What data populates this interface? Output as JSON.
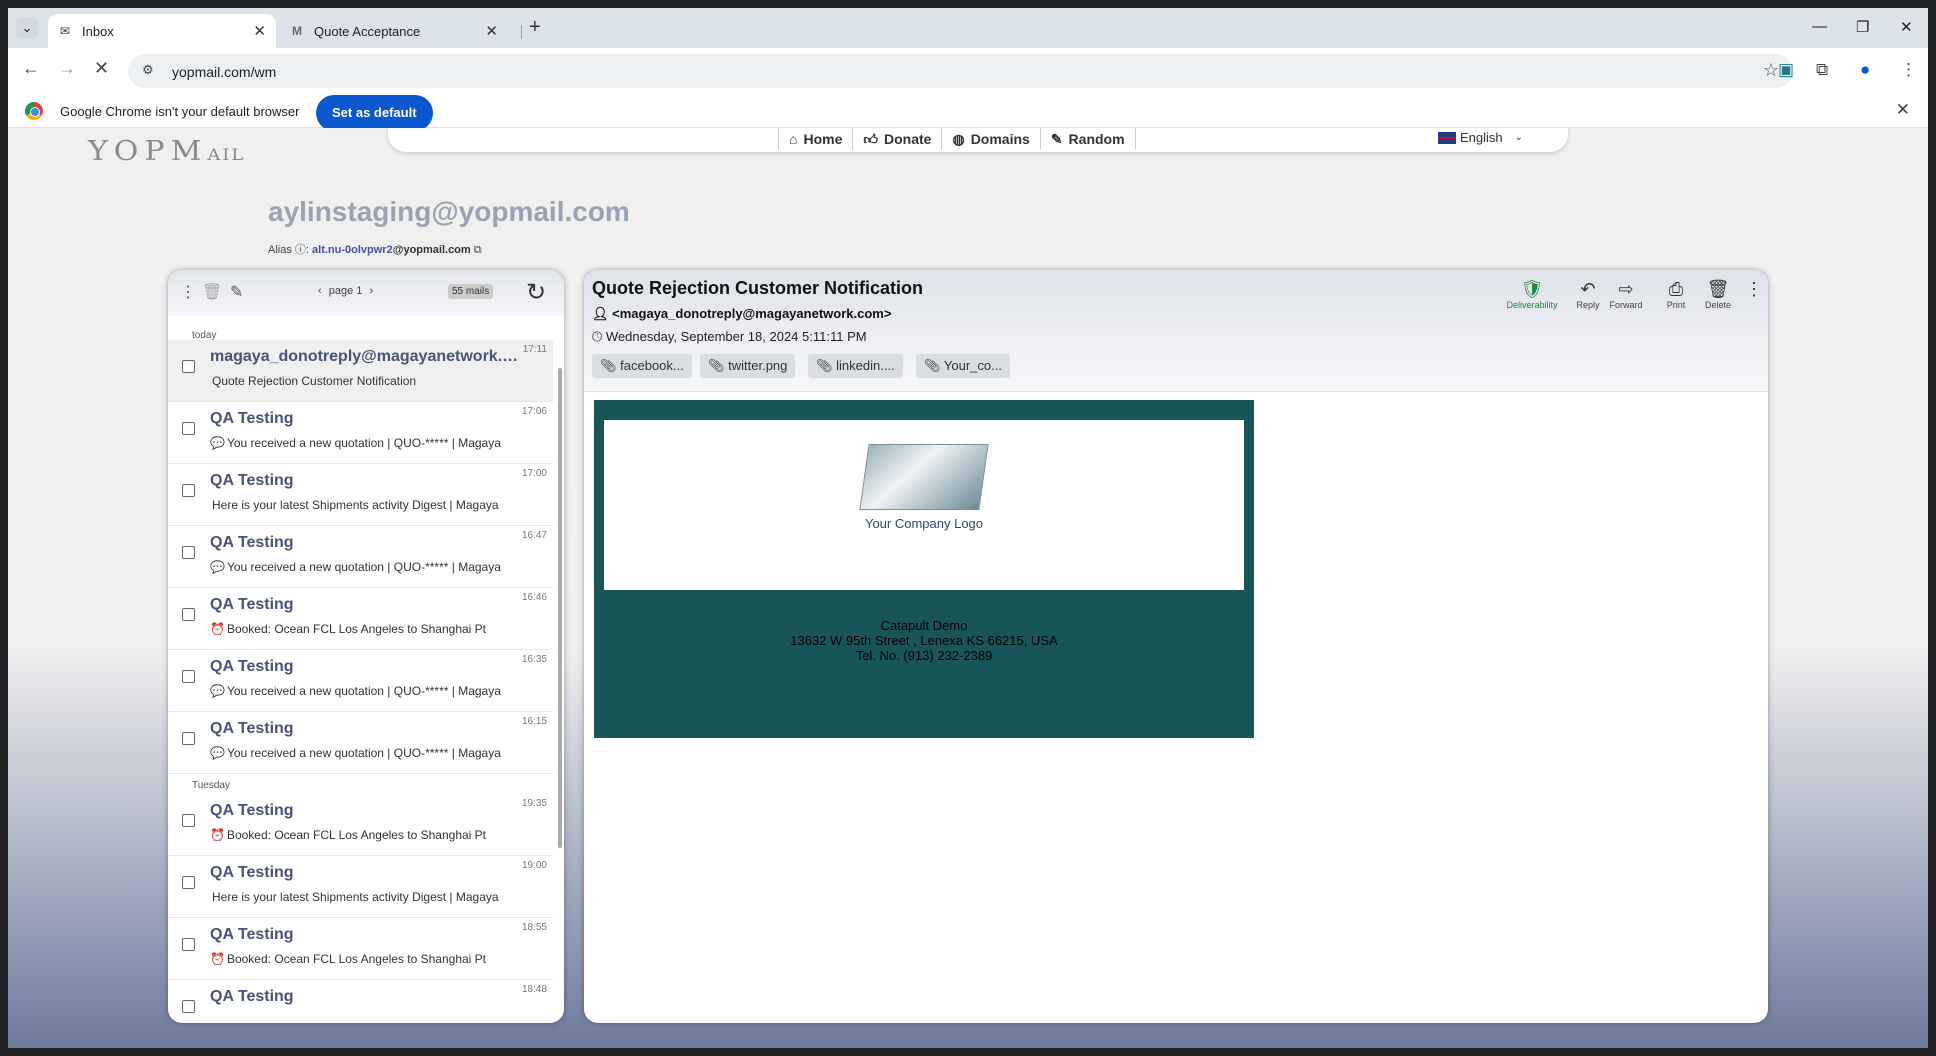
{
  "browser": {
    "tabs": [
      {
        "title": "Inbox",
        "active": true
      },
      {
        "title": "Quote Acceptance",
        "active": false
      }
    ],
    "url": "yopmail.com/wm",
    "infobar": {
      "message": "Google Chrome isn't your default browser",
      "button": "Set as default"
    }
  },
  "site": {
    "logo": "YOPMAIL",
    "nav": [
      "Home",
      "Donate",
      "Domains",
      "Random"
    ],
    "language": "English",
    "mailbox": "aylinstaging@yopmail.com",
    "alias_label": "Alias",
    "alias_link": "alt.nu-0olvpwr2",
    "alias_domain": "@yopmail.com"
  },
  "inbox": {
    "page": "page 1",
    "count": "55 mails",
    "groups": [
      {
        "day": "today",
        "mails": [
          {
            "from": "magaya_donotreply@magayanetwork.com",
            "time": "17:11",
            "subject": "Quote Rejection Customer Notification",
            "emoji": "",
            "selected": true
          },
          {
            "from": "QA Testing",
            "time": "17:06",
            "subject": "You received a new quotation | QUO-***** | Magaya",
            "emoji": "💬"
          },
          {
            "from": "QA Testing",
            "time": "17:00",
            "subject": "Here is your latest Shipments activity Digest | Magaya",
            "emoji": ""
          },
          {
            "from": "QA Testing",
            "time": "16:47",
            "subject": "You received a new quotation | QUO-***** | Magaya",
            "emoji": "💬"
          },
          {
            "from": "QA Testing",
            "time": "16:46",
            "subject": "Booked: Ocean FCL Los Angeles to Shanghai Pt",
            "emoji": "⏰"
          },
          {
            "from": "QA Testing",
            "time": "16:35",
            "subject": "You received a new quotation | QUO-***** | Magaya",
            "emoji": "💬"
          },
          {
            "from": "QA Testing",
            "time": "16:15",
            "subject": "You received a new quotation | QUO-***** | Magaya",
            "emoji": "💬"
          }
        ]
      },
      {
        "day": "Tuesday",
        "mails": [
          {
            "from": "QA Testing",
            "time": "19:35",
            "subject": "Booked: Ocean FCL Los Angeles to Shanghai Pt",
            "emoji": "⏰"
          },
          {
            "from": "QA Testing",
            "time": "19:00",
            "subject": "Here is your latest Shipments activity Digest | Magaya",
            "emoji": ""
          },
          {
            "from": "QA Testing",
            "time": "18:55",
            "subject": "Booked: Ocean FCL Los Angeles to Shanghai Pt",
            "emoji": "⏰"
          },
          {
            "from": "QA Testing",
            "time": "18:48",
            "subject": "",
            "emoji": ""
          }
        ]
      }
    ]
  },
  "message": {
    "subject": "Quote Rejection Customer Notification",
    "sender": "<magaya_donotreply@magayanetwork.com>",
    "date": "Wednesday, September 18, 2024 5:11:11 PM",
    "attachments": [
      "facebook...",
      "twitter.png",
      "linkedin....",
      "Your_co..."
    ],
    "actions": [
      "Deliverability",
      "Reply",
      "Forward",
      "Print",
      "Delete"
    ],
    "body": {
      "logo_text": "Your Company Logo",
      "company": "Catapult Demo",
      "address": "13632 W 95th Street , Lenexa KS 66215, USA",
      "phone": "Tel. No. (913) 232-2389"
    }
  },
  "colors": {
    "email_bg": "#185557",
    "accent_blue": "#0b57d0",
    "sender_text": "#4a5378",
    "deliverability_green": "#1a8a3a"
  }
}
